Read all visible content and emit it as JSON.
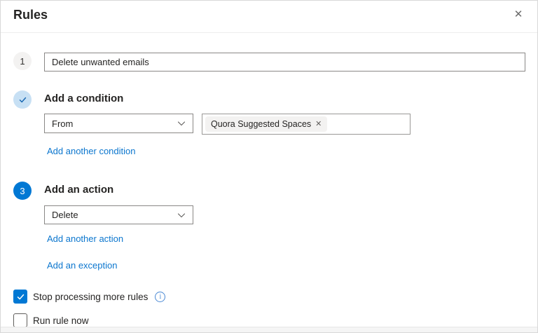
{
  "header": {
    "title": "Rules",
    "close_icon": "✕"
  },
  "steps": {
    "name": {
      "number": "1",
      "value": "Delete unwanted emails"
    },
    "condition": {
      "heading": "Add a condition",
      "select_value": "From",
      "chip_label": "Quora Suggested Spaces",
      "chip_remove_icon": "✕",
      "add_another_label": "Add another condition"
    },
    "action": {
      "number": "3",
      "heading": "Add an action",
      "select_value": "Delete",
      "add_another_label": "Add another action",
      "add_exception_label": "Add an exception"
    }
  },
  "options": {
    "stop_processing": {
      "label": "Stop processing more rules",
      "checked": true,
      "info_icon": "i"
    },
    "run_rule_now": {
      "label": "Run rule now",
      "checked": false
    }
  },
  "colors": {
    "accent_blue": "#0078d4",
    "link_blue": "#0b76ce",
    "step_complete_bg": "#c7e0f4",
    "step_complete_check": "#1565b0",
    "neutral_circle_bg": "#f3f2f1",
    "input_border": "#8a8886",
    "chip_bg": "#f3f2f1",
    "info_icon_blue": "#4a89d4",
    "footer_bg": "#f5f5f5"
  }
}
